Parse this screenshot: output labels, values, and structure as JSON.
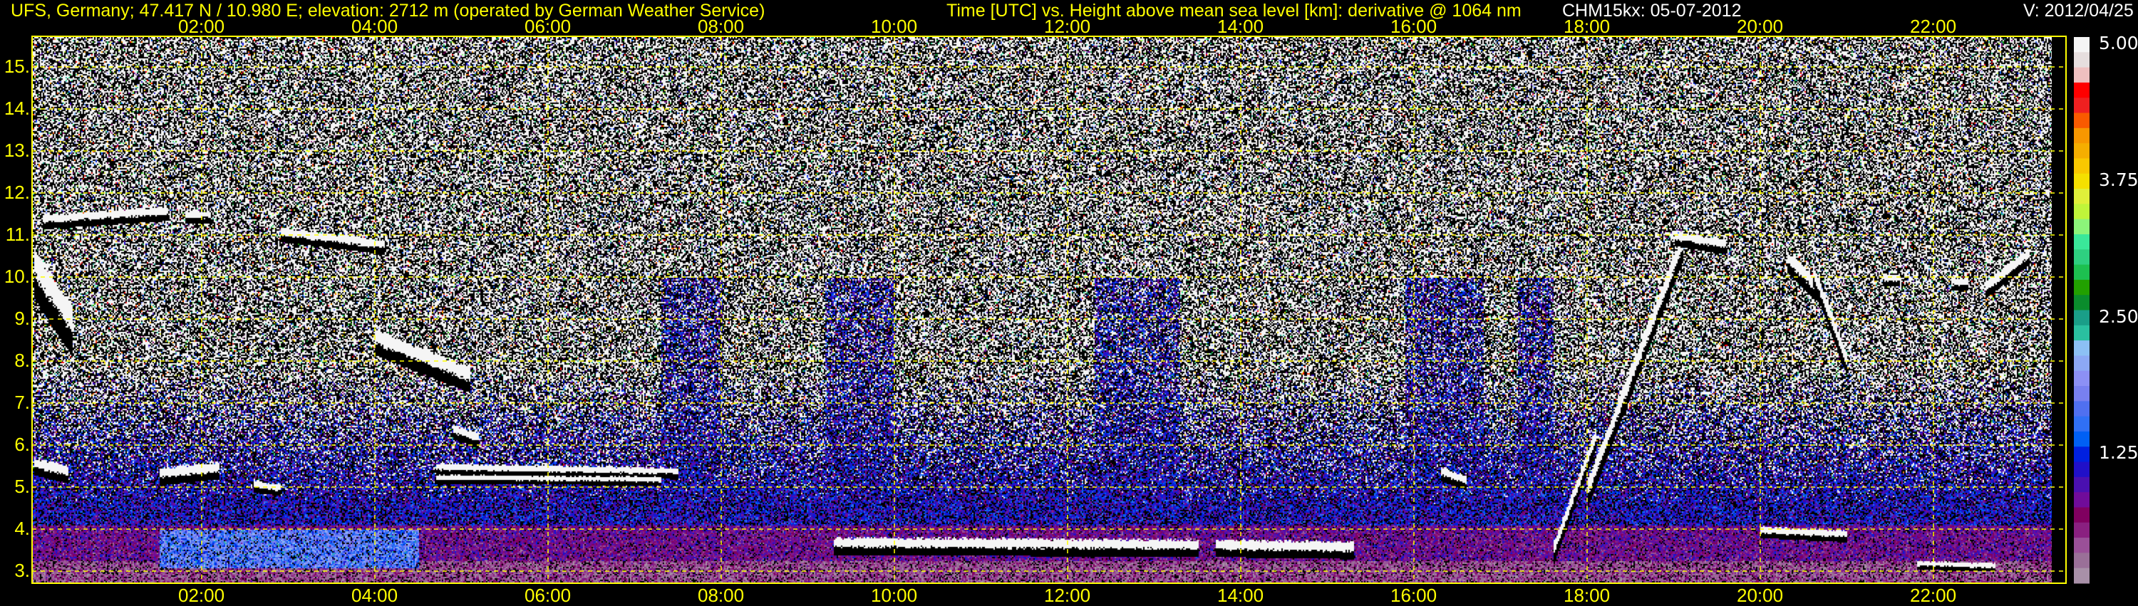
{
  "header": {
    "station": "UFS, Germany; 47.417 N / 10.980 E; elevation: 2712 m  (operated by German Weather Service)",
    "description": "Time [UTC] vs. Height above mean sea level [km]: derivative @ 1064 nm",
    "instrument_date": "CHM15kx: 05-07-2012",
    "version": "V: 2012/04/25"
  },
  "chart_data": {
    "type": "heatmap",
    "title": "Time [UTC] vs. Height above mean sea level [km]: derivative @ 1064 nm",
    "xlabel": "Time [UTC]",
    "ylabel": "Height above mean sea level [km]",
    "xlim": [
      0,
      23.37
    ],
    "ylim": [
      2.712,
      15.72
    ],
    "x_ticks": [
      2,
      4,
      6,
      8,
      10,
      12,
      14,
      16,
      18,
      20,
      22
    ],
    "x_tick_labels": [
      "02:00",
      "04:00",
      "06:00",
      "08:00",
      "10:00",
      "12:00",
      "14:00",
      "16:00",
      "18:00",
      "20:00",
      "22:00"
    ],
    "y_ticks": [
      3,
      4,
      5,
      6,
      7,
      8,
      9,
      10,
      11,
      12,
      13,
      14,
      15
    ],
    "y_tick_labels": [
      "3.",
      "4.",
      "5.",
      "6.",
      "7.",
      "8.",
      "9.",
      "10.",
      "11.",
      "12.",
      "13.",
      "14.",
      "15."
    ],
    "grid": true,
    "colorbar": {
      "range": [
        0,
        5
      ],
      "tick_labels": [
        "5.00",
        "3.75",
        "2.50",
        "1.25"
      ],
      "tick_values": [
        5.0,
        3.75,
        2.5,
        1.25
      ],
      "colors": [
        "#f5f5f5",
        "#e6dede",
        "#efc0c0",
        "#ff0000",
        "#ef2020",
        "#f95a00",
        "#f79700",
        "#f5ae00",
        "#f9c800",
        "#f5e000",
        "#e0f03a",
        "#c0f53a",
        "#8cf57a",
        "#3ae89a",
        "#2ed080",
        "#1dc050",
        "#22a000",
        "#0a8c2c",
        "#1a9e88",
        "#2ac0a0",
        "#8cc0f5",
        "#8ca8f5",
        "#8c90f5",
        "#7880f0",
        "#5070f0",
        "#3070f5",
        "#0060f5",
        "#0020e0",
        "#2010c8",
        "#4a10b0",
        "#700c9a",
        "#800060",
        "#8a2080",
        "#9a5098",
        "#9a7098",
        "#a890a8"
      ]
    },
    "cloud_layers": [
      {
        "t": [
          0.05,
          0.5
        ],
        "h": [
          10.4,
          9.0
        ],
        "w": 0.35
      },
      {
        "t": [
          0.15,
          1.6
        ],
        "h": [
          11.4,
          11.6
        ],
        "w": 0.1
      },
      {
        "t": [
          1.8,
          2.1
        ],
        "h": [
          11.5,
          11.5
        ],
        "w": 0.08
      },
      {
        "t": [
          2.9,
          4.1
        ],
        "h": [
          11.1,
          10.8
        ],
        "w": 0.1
      },
      {
        "t": [
          4.0,
          5.1
        ],
        "h": [
          8.6,
          7.7
        ],
        "w": 0.18
      },
      {
        "t": [
          0.05,
          0.45
        ],
        "h": [
          5.6,
          5.4
        ],
        "w": 0.12
      },
      {
        "t": [
          1.5,
          2.2
        ],
        "h": [
          5.35,
          5.5
        ],
        "w": 0.12
      },
      {
        "t": [
          2.6,
          2.9
        ],
        "h": [
          5.1,
          5.0
        ],
        "w": 0.08
      },
      {
        "t": [
          4.7,
          7.5
        ],
        "h": [
          5.5,
          5.4
        ],
        "w": 0.08
      },
      {
        "t": [
          4.7,
          7.3
        ],
        "h": [
          5.25,
          5.2
        ],
        "w": 0.06
      },
      {
        "t": [
          4.9,
          5.2
        ],
        "h": [
          6.4,
          6.2
        ],
        "w": 0.1
      },
      {
        "t": [
          9.3,
          13.5
        ],
        "h": [
          3.7,
          3.65
        ],
        "w": 0.12
      },
      {
        "t": [
          13.7,
          15.3
        ],
        "h": [
          3.65,
          3.6
        ],
        "w": 0.12
      },
      {
        "t": [
          16.3,
          16.6
        ],
        "h": [
          5.4,
          5.2
        ],
        "w": 0.1
      },
      {
        "t": [
          17.6,
          18.1
        ],
        "h": [
          3.5,
          6.3
        ],
        "w": 0.15
      },
      {
        "t": [
          18.0,
          19.1
        ],
        "h": [
          5.0,
          10.9
        ],
        "w": 0.2
      },
      {
        "t": [
          19.0,
          19.6
        ],
        "h": [
          11.0,
          10.8
        ],
        "w": 0.1
      },
      {
        "t": [
          20.3,
          20.7
        ],
        "h": [
          10.5,
          9.7
        ],
        "w": 0.15
      },
      {
        "t": [
          20.6,
          21.0
        ],
        "h": [
          10.2,
          8.0
        ],
        "w": 0.15
      },
      {
        "t": [
          21.4,
          21.6
        ],
        "h": [
          10.0,
          10.0
        ],
        "w": 0.08
      },
      {
        "t": [
          22.2,
          22.4
        ],
        "h": [
          9.9,
          9.9
        ],
        "w": 0.08
      },
      {
        "t": [
          22.6,
          23.1
        ],
        "h": [
          9.8,
          10.6
        ],
        "w": 0.12
      },
      {
        "t": [
          20.0,
          21.0
        ],
        "h": [
          4.0,
          3.9
        ],
        "w": 0.08
      },
      {
        "t": [
          21.8,
          22.7
        ],
        "h": [
          3.2,
          3.15
        ],
        "w": 0.06
      }
    ],
    "aerosol_bands": [
      {
        "t": [
          1.5,
          4.5
        ],
        "h": [
          3.1,
          4.0
        ],
        "level": 1.7
      }
    ],
    "low_noise_periods": [
      [
        7.3,
        8.0
      ],
      [
        9.2,
        10.0
      ],
      [
        12.3,
        13.3
      ],
      [
        15.9,
        16.8
      ],
      [
        17.2,
        17.6
      ]
    ]
  }
}
